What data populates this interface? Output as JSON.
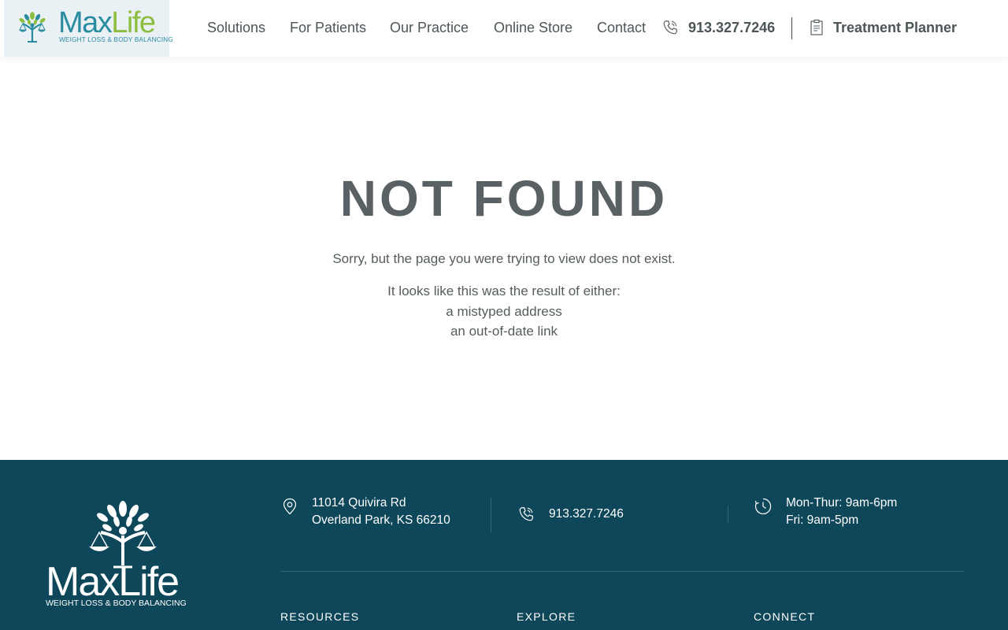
{
  "header": {
    "logo": {
      "max": "Max",
      "life": "Life",
      "tagline": "WEIGHT LOSS & BODY BALANCING"
    },
    "nav": [
      "Solutions",
      "For Patients",
      "Our Practice",
      "Online Store",
      "Contact"
    ],
    "phone": "913.327.7246",
    "planner": "Treatment Planner"
  },
  "main": {
    "title": "NOT FOUND",
    "line1": "Sorry, but the page you were trying to view does not exist.",
    "line2": "It looks like this was the result of either:",
    "line3": "a mistyped address",
    "line4": "an out-of-date link"
  },
  "footer": {
    "logo": {
      "word": "MaxLife",
      "tagline": "WEIGHT LOSS & BODY BALANCING"
    },
    "address": {
      "line1": "11014 Quivira Rd",
      "line2": "Overland Park, KS 66210"
    },
    "phone": "913.327.7246",
    "hours": {
      "line1": "Mon-Thur: 9am-6pm",
      "line2": "Fri: 9am-5pm"
    },
    "columns": [
      "RESOURCES",
      "EXPLORE",
      "CONNECT"
    ]
  },
  "colors": {
    "brand_teal": "#2a8ca0",
    "brand_green": "#8cbd3f",
    "footer_bg": "#0e4759"
  },
  "icons": [
    "logo-tree-icon",
    "phone-icon",
    "clipboard-icon",
    "map-pin-icon",
    "clock-icon"
  ]
}
